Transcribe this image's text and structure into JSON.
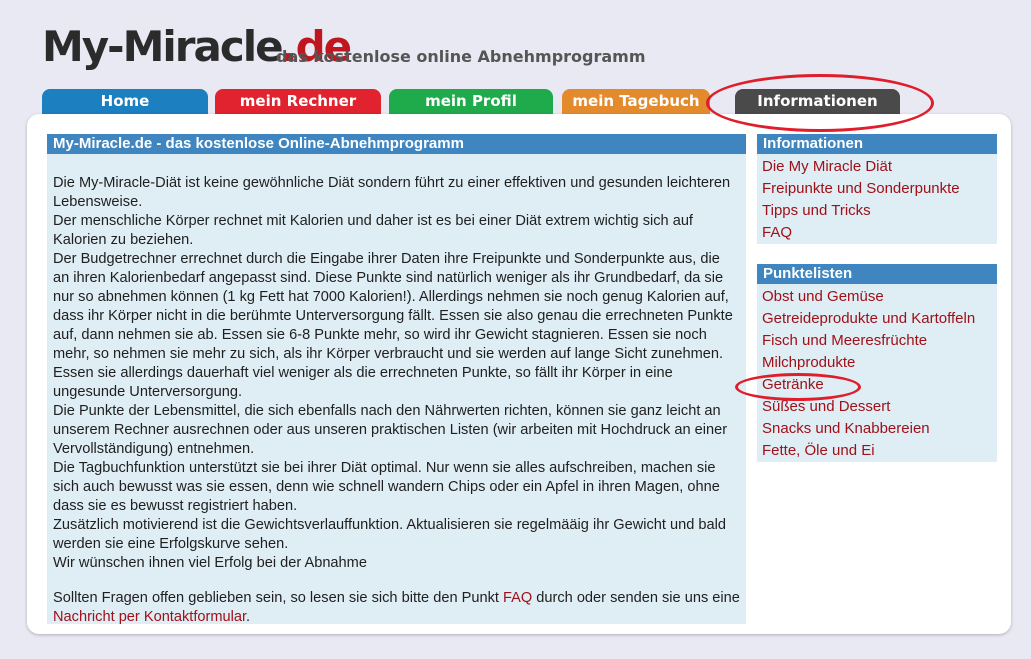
{
  "header": {
    "logo_brand": "My-Miracle",
    "logo_tld": ".de",
    "slogan": "das kostenlose online Abnehmprogramm"
  },
  "tabs": [
    {
      "label": "Home",
      "color": "#1c7fbf"
    },
    {
      "label": "mein Rechner",
      "color": "#e0232e"
    },
    {
      "label": "mein Profil",
      "color": "#1faa4b"
    },
    {
      "label": "mein Tagebuch",
      "color": "#e38a2c"
    },
    {
      "label": "Informationen",
      "color": "#4a4a4a"
    }
  ],
  "main": {
    "title": "My-Miracle.de - das kostenlose Online-Abnehmprogramm",
    "paragraphs": [
      "Die My-Miracle-Diät ist keine gewöhnliche Diät sondern führt zu einer effektiven und gesunden leichteren Lebensweise.",
      "Der menschliche Körper rechnet mit Kalorien und daher ist es bei einer Diät extrem wichtig sich auf Kalorien zu beziehen.",
      "Der Budgetrechner errechnet durch die Eingabe ihrer Daten ihre Freipunkte und Sonderpunkte aus, die an ihren Kalorienbedarf angepasst sind. Diese Punkte sind natürlich weniger als ihr Grundbedarf, da sie nur so abnehmen können (1 kg Fett hat 7000 Kalorien!). Allerdings nehmen sie noch genug Kalorien auf, dass ihr Körper nicht in die berühmte Unterversorgung fällt. Essen sie also genau die errechneten Punkte auf, dann nehmen sie ab. Essen sie 6-8 Punkte mehr, so wird ihr Gewicht stagnieren. Essen sie noch mehr, so nehmen sie mehr zu sich, als ihr Körper verbraucht und sie werden auf lange Sicht zunehmen. Essen sie allerdings dauerhaft viel weniger als die errechneten Punkte, so fällt ihr Körper in eine ungesunde Unterversorgung.",
      "Die Punkte der Lebensmittel, die sich ebenfalls nach den Nährwerten richten, können sie ganz leicht an unserem Rechner ausrechnen oder aus unseren praktischen Listen (wir arbeiten mit Hochdruck an einer Vervollständigung) entnehmen.",
      "Die Tagbuchfunktion unterstützt sie bei ihrer Diät optimal. Nur wenn sie alles aufschreiben, machen sie sich auch bewusst was sie essen, denn wie schnell wandern Chips oder ein Apfel in ihren Magen, ohne dass sie es bewusst registriert haben.",
      "Zusätzlich motivierend ist die Gewichtsverlauffunktion. Aktualisieren sie regelmääig ihr Gewicht und bald werden sie eine Erfolgskurve sehen.",
      "Wir wünschen ihnen viel Erfolg bei der Abnahme"
    ],
    "closing_pre": "Sollten Fragen offen geblieben sein, so lesen sie sich bitte den Punkt ",
    "closing_link_faq": "FAQ",
    "closing_mid": " durch oder senden sie uns eine ",
    "closing_link_contact": "Nachricht per Kontaktformular",
    "closing_post": "."
  },
  "sidebar": {
    "info_title": "Informationen",
    "info_links": [
      "Die My Miracle Diät",
      "Freipunkte und Sonderpunkte",
      "Tipps und Tricks",
      "FAQ"
    ],
    "punkte_title": "Punktelisten",
    "punkte_links": [
      "Obst und Gemüse",
      "Getreideprodukte und Kartoffeln",
      "Fisch und Meeresfrüchte",
      "Milchprodukte",
      "Getränke",
      "Süßes und Dessert",
      "Snacks und Knabbereien",
      "Fette, Öle und Ei"
    ]
  },
  "colors": {
    "background": "#e9e9f4",
    "header_bar": "#3f86c0",
    "content_bg": "#dfedf5",
    "link": "#a01018",
    "annotation": "#e01d2b"
  }
}
